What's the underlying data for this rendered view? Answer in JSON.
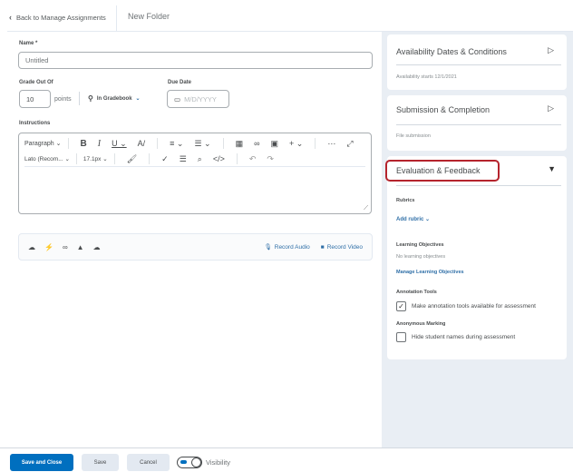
{
  "header": {
    "back_label": "Back to Manage Assignments",
    "title": "New Folder"
  },
  "form": {
    "name_label": "Name *",
    "name_value": "Untitled",
    "grade_label": "Grade Out Of",
    "grade_value": "10",
    "points_label": "points",
    "gradebook_label": "In Gradebook",
    "due_label": "Due Date",
    "due_placeholder": "M/D/YYYY",
    "instructions_label": "Instructions",
    "toolbar": {
      "paragraph": "Paragraph",
      "font": "Lato (Recom...",
      "size": "17.1px"
    },
    "record_audio": "Record Audio",
    "record_video": "Record Video"
  },
  "side": {
    "availability": {
      "title": "Availability Dates & Conditions",
      "summary": "Availability starts 12/1/2021"
    },
    "submission": {
      "title": "Submission & Completion",
      "summary": "File submission"
    },
    "evaluation": {
      "title": "Evaluation & Feedback",
      "rubrics_label": "Rubrics",
      "add_rubric": "Add rubric",
      "lo_label": "Learning Objectives",
      "lo_none": "No learning objectives",
      "lo_manage": "Manage Learning Objectives",
      "annotation_label": "Annotation Tools",
      "annotation_option": "Make annotation tools available for assessment",
      "annotation_checked": true,
      "anon_label": "Anonymous Marking",
      "anon_option": "Hide student names during assessment",
      "anon_checked": false
    }
  },
  "footer": {
    "save_close": "Save and Close",
    "save": "Save",
    "cancel": "Cancel",
    "visibility": "Visibility"
  },
  "colors": {
    "primary": "#006fbf",
    "highlight": "#b5242d",
    "link": "#2f6fa7"
  }
}
